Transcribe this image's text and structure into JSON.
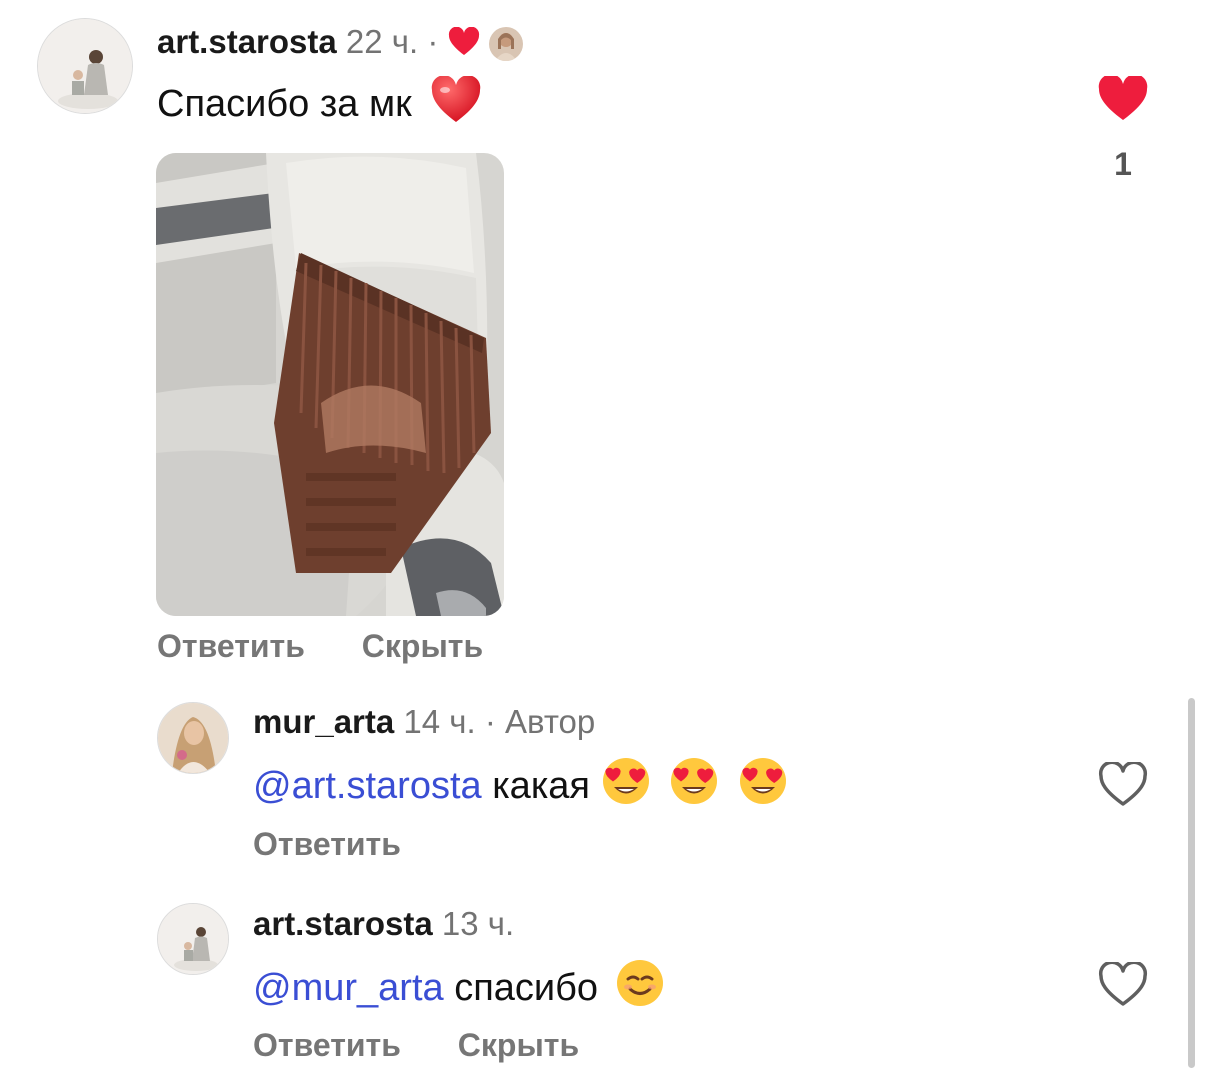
{
  "comments": [
    {
      "username": "art.starosta",
      "time": "22 ч.",
      "separator": "·",
      "text": "Спасибо за мк",
      "text_emoji": "red-heart",
      "author_liked": true,
      "likes": "1",
      "liked": true,
      "has_photo": true,
      "actions": {
        "reply": "Ответить",
        "hide": "Скрыть"
      }
    },
    {
      "username": "mur_arta",
      "time": "14 ч.",
      "separator": "·",
      "author_label": "Автор",
      "mention": "@art.starosta",
      "text": "какая",
      "text_emoji": "heart-eyes-face x3",
      "liked": false,
      "actions": {
        "reply": "Ответить"
      }
    },
    {
      "username": "art.starosta",
      "time": "13 ч.",
      "mention": "@mur_arta",
      "text": "спасибо",
      "text_emoji": "smiling-face",
      "liked": false,
      "actions": {
        "reply": "Ответить",
        "hide": "Скрыть"
      }
    }
  ],
  "colors": {
    "like_red": "#ee1d3d",
    "mention_blue": "#3a4ed4",
    "secondary_gray": "#737373"
  }
}
